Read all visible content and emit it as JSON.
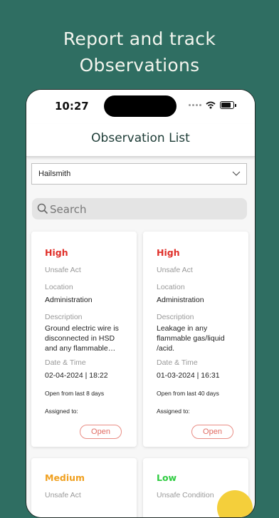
{
  "promo": {
    "line1": "Report and track",
    "line2": "Observations"
  },
  "status_bar": {
    "time": "10:27"
  },
  "header": {
    "title": "Observation List"
  },
  "filter": {
    "selected": "Hailsmith"
  },
  "search": {
    "placeholder": "Search"
  },
  "cards": [
    {
      "priority": "High",
      "priority_color": "#e0302a",
      "type": "Unsafe Act",
      "location_label": "Location",
      "location": "Administration",
      "description_label": "Description",
      "description": "Ground electric wire is disconnected in HSD and any flammable…",
      "datetime_label": "Date & Time",
      "datetime": "02-04-2024 | 18:22",
      "open_from": "Open from last 8 days",
      "assigned_label": "Assigned to:",
      "status": "Open"
    },
    {
      "priority": "High",
      "priority_color": "#e0302a",
      "type": "Unsafe Act",
      "location_label": "Location",
      "location": "Administration",
      "description_label": "Description",
      "description": "Leakage in any flammable gas/liquid /acid.",
      "datetime_label": "Date & Time",
      "datetime": "01-03-2024 | 16:31",
      "open_from": "Open from last 40 days",
      "assigned_label": "Assigned to:",
      "status": "Open"
    },
    {
      "priority": "Medium",
      "priority_color": "#f0a020",
      "type": "Unsafe Act"
    },
    {
      "priority": "Low",
      "priority_color": "#2ecc40",
      "type": "Unsafe Condition"
    }
  ],
  "colors": {
    "background": "#2f6e62",
    "fab": "#f4cf3b",
    "open_border": "#e98d85"
  }
}
